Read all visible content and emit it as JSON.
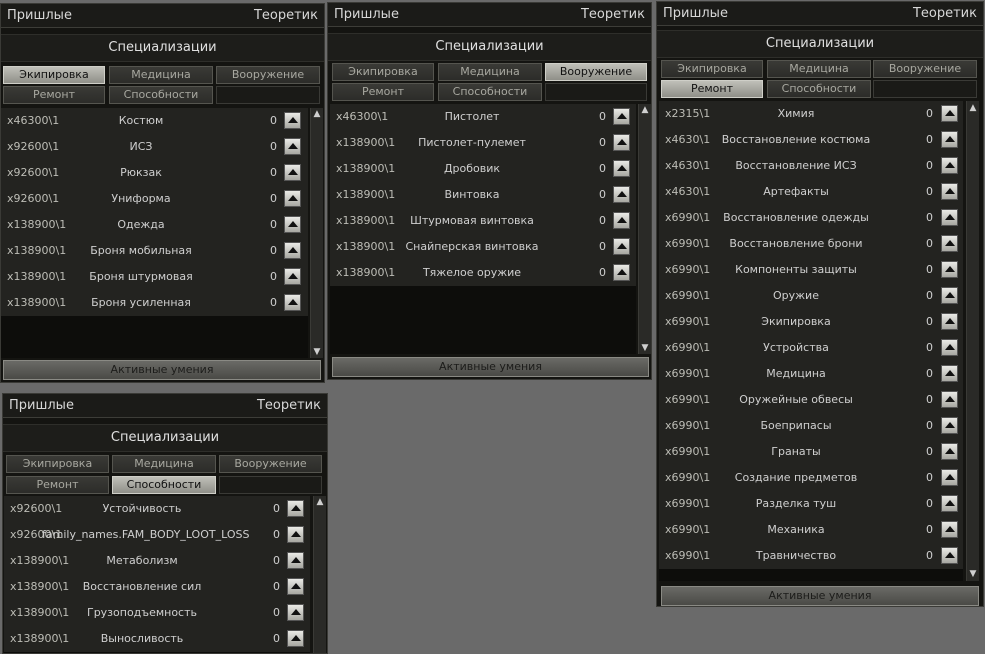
{
  "tabs": {
    "equipment": "Экипировка",
    "medicine": "Медицина",
    "weapons": "Вооружение",
    "repair": "Ремонт",
    "abilities": "Способности"
  },
  "panels": [
    {
      "title_left": "Пришлые",
      "title_right": "Теоретик",
      "spec_header": "Специализации",
      "active_tab": "equipment",
      "footer": "Активные умения",
      "rows": [
        {
          "cost": "x46300\\1",
          "name": "Костюм",
          "level": "0"
        },
        {
          "cost": "x92600\\1",
          "name": "ИСЗ",
          "level": "0"
        },
        {
          "cost": "x92600\\1",
          "name": "Рюкзак",
          "level": "0"
        },
        {
          "cost": "x92600\\1",
          "name": "Униформа",
          "level": "0"
        },
        {
          "cost": "x138900\\1",
          "name": "Одежда",
          "level": "0"
        },
        {
          "cost": "x138900\\1",
          "name": "Броня мобильная",
          "level": "0"
        },
        {
          "cost": "x138900\\1",
          "name": "Броня штурмовая",
          "level": "0"
        },
        {
          "cost": "x138900\\1",
          "name": "Броня усиленная",
          "level": "0"
        }
      ]
    },
    {
      "title_left": "Пришлые",
      "title_right": "Теоретик",
      "spec_header": "Специализации",
      "active_tab": "weapons",
      "footer": "Активные умения",
      "rows": [
        {
          "cost": "x46300\\1",
          "name": "Пистолет",
          "level": "0"
        },
        {
          "cost": "x138900\\1",
          "name": "Пистолет-пулемет",
          "level": "0"
        },
        {
          "cost": "x138900\\1",
          "name": "Дробовик",
          "level": "0"
        },
        {
          "cost": "x138900\\1",
          "name": "Винтовка",
          "level": "0"
        },
        {
          "cost": "x138900\\1",
          "name": "Штурмовая винтовка",
          "level": "0"
        },
        {
          "cost": "x138900\\1",
          "name": "Снайперская винтовка",
          "level": "0"
        },
        {
          "cost": "x138900\\1",
          "name": "Тяжелое оружие",
          "level": "0"
        }
      ]
    },
    {
      "title_left": "Пришлые",
      "title_right": "Теоретик",
      "spec_header": "Специализации",
      "active_tab": "repair",
      "footer": "Активные умения",
      "rows": [
        {
          "cost": "x2315\\1",
          "name": "Химия",
          "level": "0"
        },
        {
          "cost": "x4630\\1",
          "name": "Восстановление костюма",
          "level": "0"
        },
        {
          "cost": "x4630\\1",
          "name": "Восстановление ИСЗ",
          "level": "0"
        },
        {
          "cost": "x4630\\1",
          "name": "Артефакты",
          "level": "0"
        },
        {
          "cost": "x6990\\1",
          "name": "Восстановление одежды",
          "level": "0"
        },
        {
          "cost": "x6990\\1",
          "name": "Восстановление брони",
          "level": "0"
        },
        {
          "cost": "x6990\\1",
          "name": "Компоненты защиты",
          "level": "0"
        },
        {
          "cost": "x6990\\1",
          "name": "Оружие",
          "level": "0"
        },
        {
          "cost": "x6990\\1",
          "name": "Экипировка",
          "level": "0"
        },
        {
          "cost": "x6990\\1",
          "name": "Устройства",
          "level": "0"
        },
        {
          "cost": "x6990\\1",
          "name": "Медицина",
          "level": "0"
        },
        {
          "cost": "x6990\\1",
          "name": "Оружейные обвесы",
          "level": "0"
        },
        {
          "cost": "x6990\\1",
          "name": "Боеприпасы",
          "level": "0"
        },
        {
          "cost": "x6990\\1",
          "name": "Гранаты",
          "level": "0"
        },
        {
          "cost": "x6990\\1",
          "name": "Создание предметов",
          "level": "0"
        },
        {
          "cost": "x6990\\1",
          "name": "Разделка туш",
          "level": "0"
        },
        {
          "cost": "x6990\\1",
          "name": "Механика",
          "level": "0"
        },
        {
          "cost": "x6990\\1",
          "name": "Травничество",
          "level": "0"
        }
      ]
    },
    {
      "title_left": "Пришлые",
      "title_right": "Теоретик",
      "spec_header": "Специализации",
      "active_tab": "abilities",
      "footer": "",
      "rows": [
        {
          "cost": "x92600\\1",
          "name": "Устойчивость",
          "level": "0"
        },
        {
          "cost": "x92600\\1",
          "name": "family_names.FAM_BODY_LOOT_LOSS",
          "level": "0"
        },
        {
          "cost": "x138900\\1",
          "name": "Метаболизм",
          "level": "0"
        },
        {
          "cost": "x138900\\1",
          "name": "Восстановление сил",
          "level": "0"
        },
        {
          "cost": "x138900\\1",
          "name": "Грузоподъемность",
          "level": "0"
        },
        {
          "cost": "x138900\\1",
          "name": "Выносливость",
          "level": "0"
        }
      ]
    }
  ]
}
